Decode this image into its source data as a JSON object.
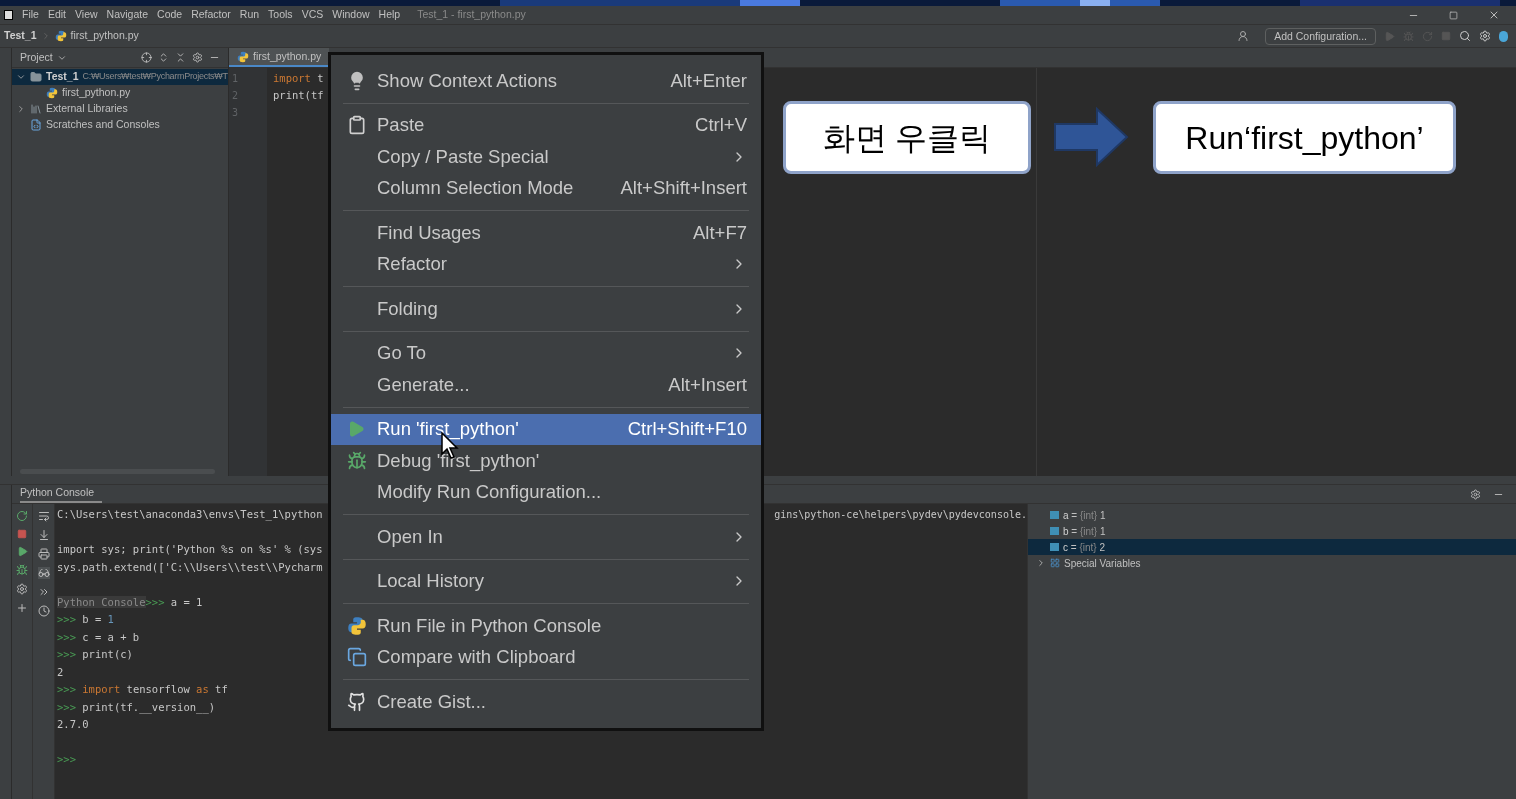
{
  "menu_bar": {
    "items": [
      "File",
      "Edit",
      "View",
      "Navigate",
      "Code",
      "Refactor",
      "Run",
      "Tools",
      "VCS",
      "Window",
      "Help"
    ],
    "title": "Test_1 - first_python.py"
  },
  "nav_bar": {
    "breadcrumbs": [
      "Test_1",
      "first_python.py"
    ],
    "run_config": "Add Configuration..."
  },
  "project_panel": {
    "title": "Project",
    "tree": [
      {
        "label": "Test_1",
        "path": "C:₩Users₩test₩PycharmProjects₩T",
        "kind": "folder",
        "expanded": true,
        "children": [
          {
            "label": "first_python.py",
            "kind": "python"
          }
        ]
      },
      {
        "label": "External Libraries",
        "kind": "library",
        "expanded": false
      },
      {
        "label": "Scratches and Consoles",
        "kind": "scratch"
      }
    ]
  },
  "editor": {
    "tab": "first_python.py",
    "line_numbers": [
      "1",
      "2",
      "3"
    ],
    "lines": [
      [
        {
          "text": "import",
          "kind": "keyword"
        },
        {
          "text": " t",
          "kind": "plain"
        }
      ],
      [
        {
          "text": "print(tf",
          "kind": "plain"
        }
      ]
    ]
  },
  "console": {
    "title": "Python Console",
    "lines": [
      {
        "kind": "text",
        "segments": [
          {
            "text": "C:\\Users\\test\\anaconda3\\envs\\Test_1\\python",
            "kind": "plain"
          }
        ],
        "tail": "gins\\python-ce\\helpers\\pydev\\pydevconsole."
      },
      {
        "kind": "blank"
      },
      {
        "kind": "text",
        "segments": [
          {
            "text": "import sys; print('Python %s on %s' % (sys",
            "kind": "plain"
          }
        ]
      },
      {
        "kind": "text",
        "segments": [
          {
            "text": "sys.path.extend(['C:\\\\Users\\\\test\\\\Pycharm",
            "kind": "plain"
          }
        ]
      },
      {
        "kind": "blank"
      },
      {
        "kind": "text",
        "segments": [
          {
            "text": "Python Console",
            "kind": "label"
          },
          {
            "text": ">>>",
            "kind": "prompt"
          },
          {
            "text": " a = 1",
            "kind": "plain"
          }
        ]
      },
      {
        "kind": "text",
        "segments": [
          {
            "text": ">>>",
            "kind": "prompt"
          },
          {
            "text": " b = ",
            "kind": "plain"
          },
          {
            "text": "1",
            "kind": "number"
          }
        ]
      },
      {
        "kind": "text",
        "segments": [
          {
            "text": ">>>",
            "kind": "prompt"
          },
          {
            "text": " c = a + b",
            "kind": "plain"
          }
        ]
      },
      {
        "kind": "text",
        "segments": [
          {
            "text": ">>>",
            "kind": "prompt"
          },
          {
            "text": " print(c)",
            "kind": "plain"
          }
        ]
      },
      {
        "kind": "text",
        "segments": [
          {
            "text": "2",
            "kind": "plain"
          }
        ]
      },
      {
        "kind": "text",
        "segments": [
          {
            "text": ">>>",
            "kind": "prompt"
          },
          {
            "text": " import",
            "kind": "keyword"
          },
          {
            "text": " tensorflow ",
            "kind": "plain"
          },
          {
            "text": "as",
            "kind": "keyword"
          },
          {
            "text": " tf",
            "kind": "plain"
          }
        ]
      },
      {
        "kind": "text",
        "segments": [
          {
            "text": ">>>",
            "kind": "prompt"
          },
          {
            "text": " print(tf.__version__)",
            "kind": "plain"
          }
        ]
      },
      {
        "kind": "text",
        "segments": [
          {
            "text": "2.7.0",
            "kind": "plain"
          }
        ]
      },
      {
        "kind": "blank"
      },
      {
        "kind": "text",
        "segments": [
          {
            "text": ">>>",
            "kind": "prompt"
          }
        ]
      }
    ],
    "variables": [
      {
        "name": "a",
        "op": "=",
        "type": "{int}",
        "value": "1",
        "selected": false
      },
      {
        "name": "b",
        "op": "=",
        "type": "{int}",
        "value": "1",
        "selected": false
      },
      {
        "name": "c",
        "op": "=",
        "type": "{int}",
        "value": "2",
        "selected": true
      }
    ],
    "special": "Special Variables"
  },
  "context_menu": {
    "groups": [
      [
        {
          "label": "Show Context Actions",
          "shortcut": "Alt+Enter",
          "selected": false
        }
      ],
      [
        {
          "label": "Paste",
          "shortcut": "Ctrl+V",
          "selected": false
        },
        {
          "label": "Copy / Paste Special",
          "submenu": true,
          "selected": false
        },
        {
          "label": "Column Selection Mode",
          "shortcut": "Alt+Shift+Insert",
          "selected": false
        }
      ],
      [
        {
          "label": "Find Usages",
          "shortcut": "Alt+F7",
          "selected": false
        },
        {
          "label": "Refactor",
          "submenu": true,
          "selected": false
        }
      ],
      [
        {
          "label": "Folding",
          "submenu": true,
          "selected": false
        }
      ],
      [
        {
          "label": "Go To",
          "submenu": true,
          "selected": false
        },
        {
          "label": "Generate...",
          "shortcut": "Alt+Insert",
          "selected": false
        }
      ],
      [
        {
          "label": "Run 'first_python'",
          "shortcut": "Ctrl+Shift+F10",
          "selected": true
        },
        {
          "label": "Debug 'first_python'",
          "selected": false
        },
        {
          "label": "Modify Run Configuration...",
          "selected": false
        }
      ],
      [
        {
          "label": "Open In",
          "submenu": true,
          "selected": false
        }
      ],
      [
        {
          "label": "Local History",
          "submenu": true,
          "selected": false
        }
      ],
      [
        {
          "label": "Run File in Python Console",
          "selected": false
        },
        {
          "label": "Compare with Clipboard",
          "selected": false
        }
      ],
      [
        {
          "label": "Create Gist...",
          "selected": false
        }
      ]
    ]
  },
  "annotation": {
    "steps": [
      "화면 우클릭",
      "Run‘first_python’"
    ]
  }
}
